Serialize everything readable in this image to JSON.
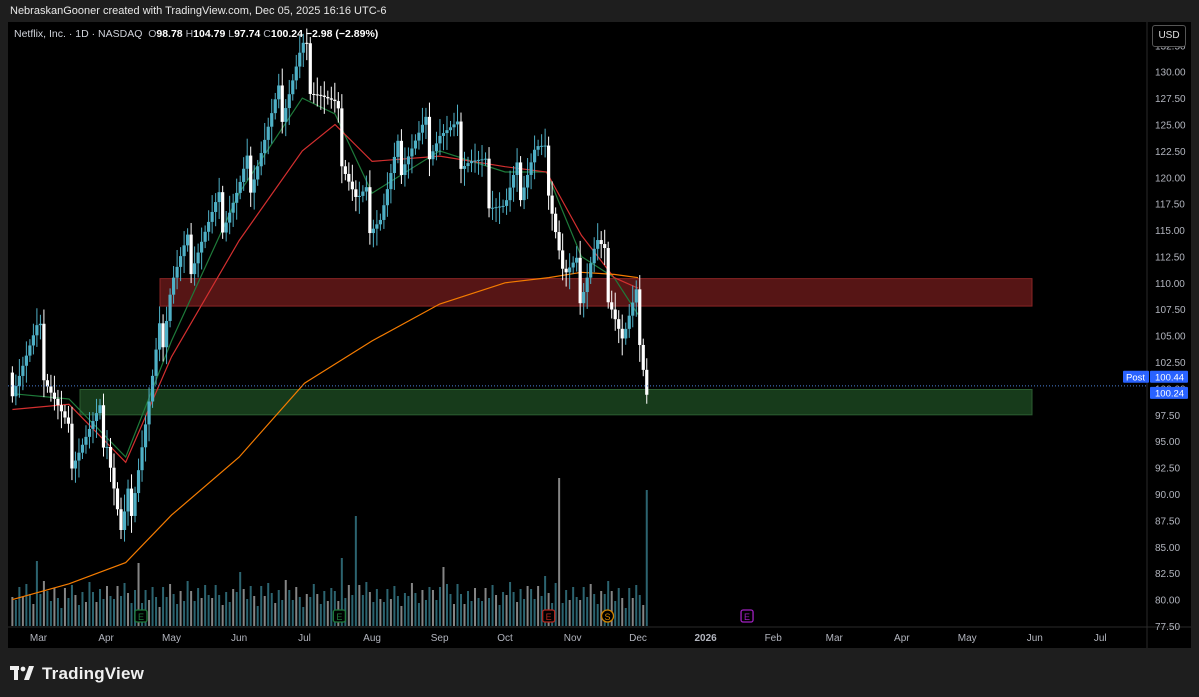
{
  "attribution": "NebraskanGooner created with TradingView.com, Dec 05, 2025 16:16 UTC-6",
  "legend": {
    "symbol": "Netflix, Inc. · 1D · NASDAQ",
    "open_label": "O",
    "open": "98.78",
    "high_label": "H",
    "high": "104.79",
    "low_label": "L",
    "low": "97.74",
    "close_label": "C",
    "close": "100.24",
    "change": "−2.98 (−2.89%)"
  },
  "currency": "USD",
  "brand": "TradingView",
  "colors": {
    "up": "#26a69a",
    "down": "#ffffff",
    "candle_up_body": "#4fb0c6",
    "ma_fast": "#1e7a3a",
    "ma_mid": "#d32f2f",
    "ma_slow": "#f57c00",
    "resistance_zone": "#6b1a1a",
    "support_zone": "#1d4a22",
    "price_tag": "#2962ff"
  },
  "chart_data": {
    "type": "candlestick",
    "title": "",
    "y_axis_ticks": [
      "77.50",
      "80.00",
      "82.50",
      "85.00",
      "87.50",
      "90.00",
      "92.50",
      "95.00",
      "97.50",
      "100.00",
      "102.50",
      "105.00",
      "107.50",
      "110.00",
      "112.50",
      "115.00",
      "117.50",
      "120.00",
      "122.50",
      "125.00",
      "127.50",
      "130.00",
      "132.50"
    ],
    "y_range": [
      77.5,
      133.0
    ],
    "x_axis_ticks": [
      "Mar",
      "Apr",
      "May",
      "Jun",
      "Jul",
      "Aug",
      "Sep",
      "Oct",
      "Nov",
      "Dec",
      "2026",
      "Feb",
      "Mar",
      "Apr",
      "May",
      "Jun",
      "Jul"
    ],
    "zones": [
      {
        "name": "resistance",
        "from": 107.8,
        "to": 110.4
      },
      {
        "name": "support",
        "from": 97.5,
        "to": 99.9
      }
    ],
    "price_labels": [
      {
        "label": "Post",
        "value": "100.44"
      },
      {
        "label": "",
        "value": "100.24"
      }
    ],
    "series": [
      {
        "name": "price",
        "x": [
          "2025-02-17",
          "2025-03-01",
          "2025-03-15",
          "2025-04-01",
          "2025-04-08",
          "2025-04-21",
          "2025-05-01",
          "2025-05-15",
          "2025-06-01",
          "2025-06-15",
          "2025-06-30",
          "2025-07-08",
          "2025-07-15",
          "2025-07-25",
          "2025-08-05",
          "2025-08-15",
          "2025-09-01",
          "2025-09-15",
          "2025-10-01",
          "2025-10-15",
          "2025-10-21",
          "2025-10-28",
          "2025-11-05",
          "2025-11-12",
          "2025-11-18",
          "2025-11-24",
          "2025-12-01",
          "2025-12-05"
        ],
        "y": [
          101.5,
          104.5,
          94.5,
          96.5,
          85.5,
          98.5,
          110.5,
          114.5,
          118.5,
          124.5,
          131.5,
          128.5,
          125.5,
          117.5,
          116.5,
          122.5,
          124.5,
          122.0,
          117.0,
          122.5,
          120.5,
          110.5,
          110.0,
          113.5,
          110.0,
          104.5,
          107.5,
          100.24
        ]
      },
      {
        "name": "ma-fast",
        "x": [
          "2025-02-17",
          "2025-03-15",
          "2025-04-10",
          "2025-05-01",
          "2025-06-01",
          "2025-06-30",
          "2025-07-15",
          "2025-08-01",
          "2025-09-01",
          "2025-10-01",
          "2025-10-20",
          "2025-11-05",
          "2025-11-20",
          "2025-12-01"
        ],
        "y": [
          99.5,
          99.0,
          93.5,
          104.5,
          118.5,
          127.5,
          126.0,
          118.5,
          122.5,
          120.5,
          120.5,
          112.5,
          110.5,
          107.0
        ]
      },
      {
        "name": "ma-mid",
        "x": [
          "2025-02-17",
          "2025-03-15",
          "2025-04-10",
          "2025-05-01",
          "2025-06-01",
          "2025-06-30",
          "2025-07-15",
          "2025-08-01",
          "2025-09-01",
          "2025-10-01",
          "2025-10-20",
          "2025-11-05",
          "2025-11-20",
          "2025-12-01"
        ],
        "y": [
          98.0,
          98.5,
          93.0,
          103.0,
          114.0,
          122.5,
          125.0,
          121.5,
          122.0,
          121.0,
          120.5,
          114.5,
          110.5,
          109.5
        ]
      },
      {
        "name": "ma-slow",
        "x": [
          "2025-02-17",
          "2025-03-15",
          "2025-04-10",
          "2025-05-01",
          "2025-06-01",
          "2025-07-01",
          "2025-08-01",
          "2025-09-01",
          "2025-10-01",
          "2025-10-21",
          "2025-11-05",
          "2025-11-20",
          "2025-12-01"
        ],
        "y": [
          80.0,
          81.5,
          83.5,
          88.0,
          93.5,
          100.5,
          104.5,
          108.0,
          110.0,
          110.5,
          111.0,
          110.8,
          110.5
        ]
      }
    ],
    "volume_labels": [
      "E",
      "E",
      "E",
      "S",
      "E"
    ]
  }
}
